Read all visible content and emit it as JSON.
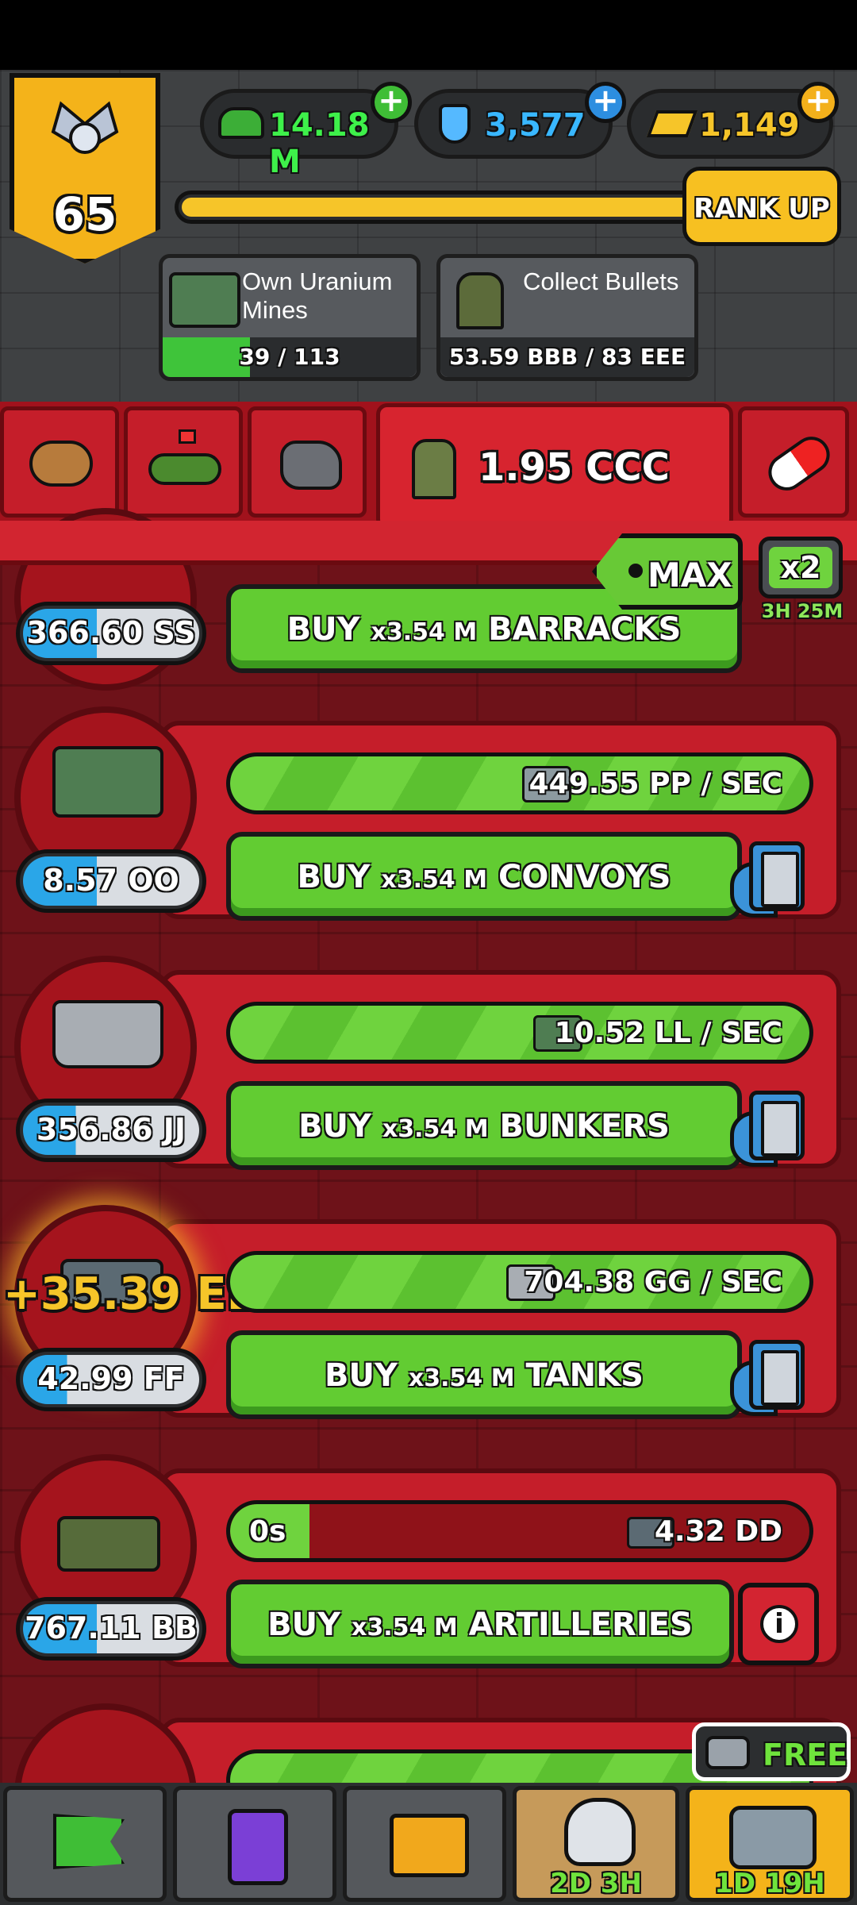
{
  "top_bar": {
    "rank_level": "65",
    "resources": [
      {
        "name": "cash",
        "value": "14.18 M",
        "icon": "cap-icon",
        "color": "#3ef04a"
      },
      {
        "name": "research",
        "value": "3,577",
        "icon": "flask-icon",
        "color": "#39b7ff"
      },
      {
        "name": "gold",
        "value": "1,149",
        "icon": "gold-bars-icon",
        "color": "#f6c529"
      }
    ],
    "xp_progress": 0.92,
    "rank_up_label": "RANK UP"
  },
  "goals": [
    {
      "title": "Own Uranium Mines",
      "progress_text": "39 / 113",
      "progress": 0.345
    },
    {
      "title": "Collect Bullets",
      "progress_text": "53.59 BBB / 83 EEE",
      "progress": 0.0
    }
  ],
  "tabs": {
    "items": [
      "potato-icon",
      "flag-field-icon",
      "ore-icon",
      "bullets-icon",
      "pill-icon"
    ],
    "active_amount": "1.95 CCC"
  },
  "multiplier": {
    "max_label": "MAX",
    "boost_label": "x2",
    "boost_timer": "3H 25M"
  },
  "units": [
    {
      "name": "barracks",
      "cost": "366.60 SS",
      "buy_label": "BUY",
      "buy_amount": "x3.54 M",
      "buy_target": "BARRACKS",
      "rate": "",
      "cost_fill": 0.45
    },
    {
      "name": "convoys",
      "cost": "8.57 OO",
      "buy_label": "BUY",
      "buy_amount": "x3.54 M",
      "buy_target": "CONVOYS",
      "rate": "449.55 PP / SEC",
      "cost_fill": 0.52
    },
    {
      "name": "bunkers",
      "cost": "356.86 JJ",
      "buy_label": "BUY",
      "buy_amount": "x3.54 M",
      "buy_target": "BUNKERS",
      "rate": "10.52 LL / SEC",
      "cost_fill": 0.35
    },
    {
      "name": "tanks",
      "cost": "42.99 FF",
      "buy_label": "BUY",
      "buy_amount": "x3.54 M",
      "buy_target": "TANKS",
      "rate": "704.38 GG / SEC",
      "cost_fill": 0.28,
      "floating_gain": "+35.39 EE"
    },
    {
      "name": "artilleries",
      "cost": "767.11 BB",
      "buy_label": "BUY",
      "buy_amount": "x3.54 M",
      "buy_target": "ARTILLERIES",
      "rate": "4.32 DD",
      "timer": "0s",
      "cost_fill": 0.5
    }
  ],
  "bottom_nav": {
    "items": [
      "flag-icon",
      "cards-icon",
      "folder-icon",
      "skull-helmet-icon",
      "chest-icon"
    ],
    "event_timer": "2D 3H",
    "chest_timer": "1D 19H",
    "free_label": "FREE"
  }
}
